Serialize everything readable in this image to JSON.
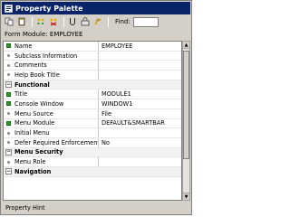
{
  "window": {
    "title": "Property Palette"
  },
  "toolbar": {
    "find_label": "Find:",
    "find_value": ""
  },
  "module_line": "Form Module: EMPLOYEE",
  "properties": [
    {
      "type": "prop",
      "marker": "green",
      "name": "Name",
      "value": "EMPLOYEE"
    },
    {
      "type": "prop",
      "marker": "dot",
      "name": "Subclass Information",
      "value": ""
    },
    {
      "type": "prop",
      "marker": "dot",
      "name": "Comments",
      "value": ""
    },
    {
      "type": "prop",
      "marker": "dot",
      "name": "Help Book Title",
      "value": ""
    },
    {
      "type": "section",
      "name": "Functional"
    },
    {
      "type": "prop",
      "marker": "green",
      "name": "Title",
      "value": "MODULE1"
    },
    {
      "type": "prop",
      "marker": "green",
      "name": "Console Window",
      "value": "WINDOW1"
    },
    {
      "type": "prop",
      "marker": "dot",
      "name": "Menu Source",
      "value": "File"
    },
    {
      "type": "prop",
      "marker": "green",
      "name": "Menu Module",
      "value": "DEFAULT&SMARTBAR"
    },
    {
      "type": "prop",
      "marker": "dot",
      "name": "Initial Menu",
      "value": ""
    },
    {
      "type": "prop",
      "marker": "dot",
      "name": "Defer Required Enforcement",
      "value": "No"
    },
    {
      "type": "section",
      "name": "Menu Security"
    },
    {
      "type": "prop",
      "marker": "dot",
      "name": "Menu Role",
      "value": ""
    },
    {
      "type": "section",
      "name": "Navigation"
    }
  ],
  "hint": "Property Hint",
  "colors": {
    "titlebar": "#0a246a",
    "marker_green": "#2e9a2e"
  },
  "icons": [
    "palette-icon",
    "copy-property-icon",
    "paste-property-icon",
    "add-property-icon",
    "delete-property-icon",
    "union-icon",
    "freeze-icon",
    "inherit-icon"
  ]
}
